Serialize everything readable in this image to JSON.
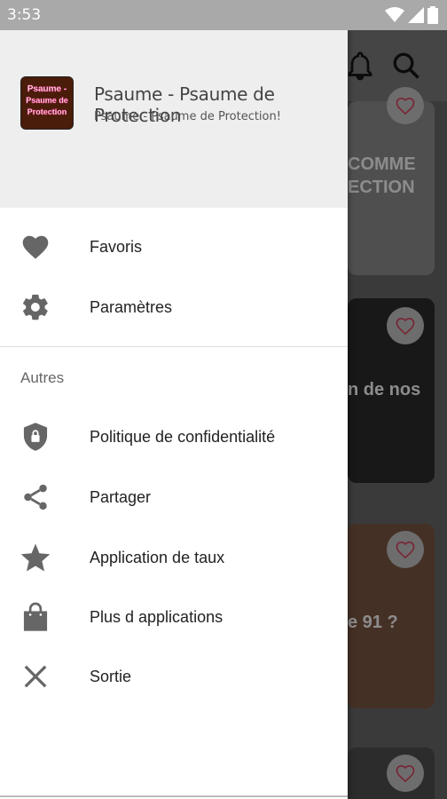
{
  "status_bar": {
    "time": "3:53"
  },
  "background": {
    "card1_text_1": "COMME",
    "card1_text_2": "ECTION",
    "card2_text": "n de nos",
    "card3_text": "e 91 ?"
  },
  "drawer": {
    "header": {
      "logo_text": "Psaume - Psaume de Protection",
      "title": "Psaume - Psaume de Protection",
      "subtitle": "Psaume - Psaume de Protection!"
    },
    "main_items": [
      {
        "label": "Favoris",
        "icon": "heart-icon"
      },
      {
        "label": "Paramètres",
        "icon": "gear-icon"
      }
    ],
    "section_label": "Autres",
    "other_items": [
      {
        "label": "Politique de confidentialité",
        "icon": "shield-lock-icon"
      },
      {
        "label": "Partager",
        "icon": "share-icon"
      },
      {
        "label": "Application de taux",
        "icon": "star-icon"
      },
      {
        "label": "Plus d applications",
        "icon": "shopping-bag-icon"
      },
      {
        "label": "Sortie",
        "icon": "close-icon"
      }
    ]
  },
  "colors": {
    "icon": "#666666",
    "header_bg": "#eeeeee",
    "status_bar": "#a9a9a9"
  }
}
